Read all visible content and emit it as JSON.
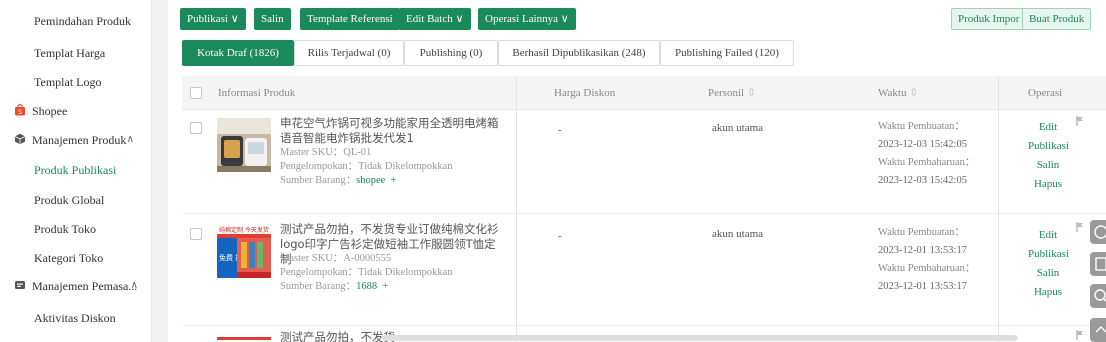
{
  "sidebar": {
    "items": [
      {
        "label": "Pemindahan Produk"
      },
      {
        "label": "Templat Harga"
      },
      {
        "label": "Templat Logo"
      },
      {
        "label": "Shopee"
      },
      {
        "label": "Manajemen Produk"
      },
      {
        "label": "Produk Publikasi"
      },
      {
        "label": "Produk Global"
      },
      {
        "label": "Produk Toko"
      },
      {
        "label": "Kategori Toko"
      },
      {
        "label": "Manajemen Pemasa..."
      },
      {
        "label": "Aktivitas Diskon"
      }
    ]
  },
  "toolbar": {
    "publish": "Publikasi",
    "copy": "Salin",
    "template": "Template Referensi",
    "edit_batch": "Edit Batch",
    "more_ops": "Operasi Lainnya",
    "import": "Produk Impor",
    "create": "Buat Produk"
  },
  "tabs": [
    {
      "label": "Kotak Draf (1826)"
    },
    {
      "label": "Rilis Terjadwal (0)"
    },
    {
      "label": "Publishing (0)"
    },
    {
      "label": "Berhasil Dipublikasikan (248)"
    },
    {
      "label": "Publishing Failed (120)"
    }
  ],
  "table": {
    "headers": {
      "info": "Informasi Produk",
      "discount": "Harga Diskon",
      "personnel": "Personil",
      "time": "Waktu",
      "ops": "Operasi"
    },
    "rows": [
      {
        "title": "申花空气炸锅可视多功能家用全透明电烤箱语音智能电炸锅批发代发1",
        "sku_label": "Master SKU：",
        "sku": "QL-01",
        "group_label": "Pengelompokan：",
        "group": "Tidak Dikelompokkan",
        "source_label": "Sumber Barang：",
        "source": "shopee",
        "plus": "+",
        "discount": "-",
        "personnel": "akun utama",
        "created_label": "Waktu Pembuatan：",
        "created": "2023-12-03 15:42:05",
        "updated_label": "Waktu Pembaharuan：",
        "updated": "2023-12-03 15:42:05",
        "ops": [
          "Edit",
          "Publikasi",
          "Salin",
          "Hapus"
        ]
      },
      {
        "title": "测试产品勿拍，不发货专业订做纯棉文化衫logo印字广告衫定做短袖工作服圆领T恤定制",
        "sku_label": "Master SKU：",
        "sku": "A-0000555",
        "group_label": "Pengelompokan：",
        "group": "Tidak Dikelompokkan",
        "source_label": "Sumber Barang：",
        "source": "1688",
        "plus": "+",
        "discount": "-",
        "personnel": "akun utama",
        "created_label": "Waktu Pembuatan：",
        "created": "2023-12-01 13:53:17",
        "updated_label": "Waktu Pembaharuan：",
        "updated": "2023-12-01 13:53:17",
        "ops": [
          "Edit",
          "Publikasi",
          "Salin",
          "Hapus"
        ]
      },
      {
        "title": "测试产品勿拍，不发货"
      }
    ]
  },
  "thumb_captions": {
    "row2_top": "纯棉定制 今天发货",
    "row2_mid": "免费 打样"
  },
  "colors": {
    "accent": "#1a8a5a",
    "shopee": "#ee4d2d"
  }
}
